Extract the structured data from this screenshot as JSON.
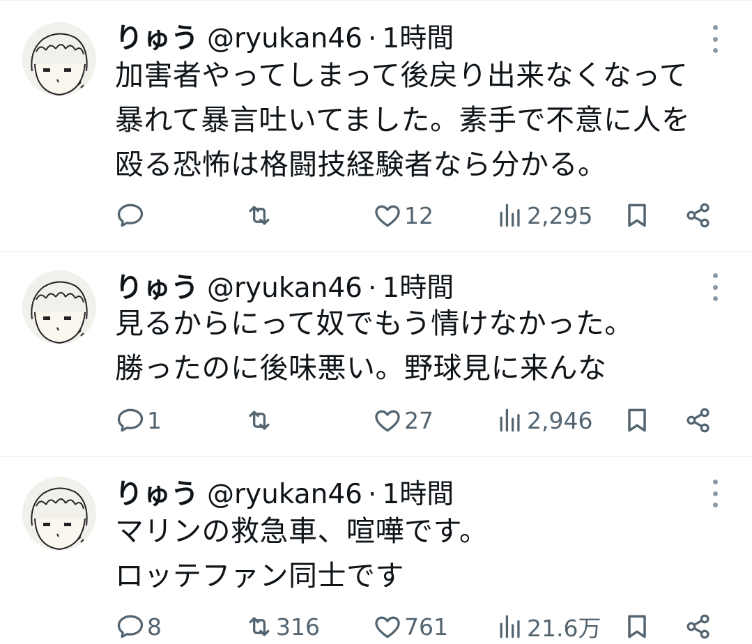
{
  "tweets": [
    {
      "name": "りゅう",
      "handle": "@ryukan46",
      "separator": "·",
      "time": "1時間",
      "lines": [
        "加害者やってしまって後戻り出来なくなって",
        "暴れて暴言吐いてました。素手で不意に人を",
        "殴る恐怖は格闘技経験者なら分かる。"
      ],
      "reply_count": "",
      "retweet_count": "",
      "like_count": "12",
      "view_count": "2,295"
    },
    {
      "name": "りゅう",
      "handle": "@ryukan46",
      "separator": "·",
      "time": "1時間",
      "lines": [
        "見るからにって奴でもう情けなかった。",
        "勝ったのに後味悪い。野球見に来んな"
      ],
      "reply_count": "1",
      "retweet_count": "",
      "like_count": "27",
      "view_count": "2,946"
    },
    {
      "name": "りゅう",
      "handle": "@ryukan46",
      "separator": "·",
      "time": "1時間",
      "lines": [
        "マリンの救急車、喧嘩です。",
        "ロッテファン同士です"
      ],
      "reply_count": "8",
      "retweet_count": "316",
      "like_count": "761",
      "view_count": "21.6万"
    }
  ],
  "icons": {
    "reply": "reply-icon",
    "retweet": "retweet-icon",
    "like": "heart-icon",
    "views": "views-icon",
    "bookmark": "bookmark-icon",
    "share": "share-icon",
    "more": "more-vertical-icon"
  },
  "colors": {
    "text": "#0f1419",
    "secondary": "#536471",
    "divider": "#eff3f4"
  }
}
